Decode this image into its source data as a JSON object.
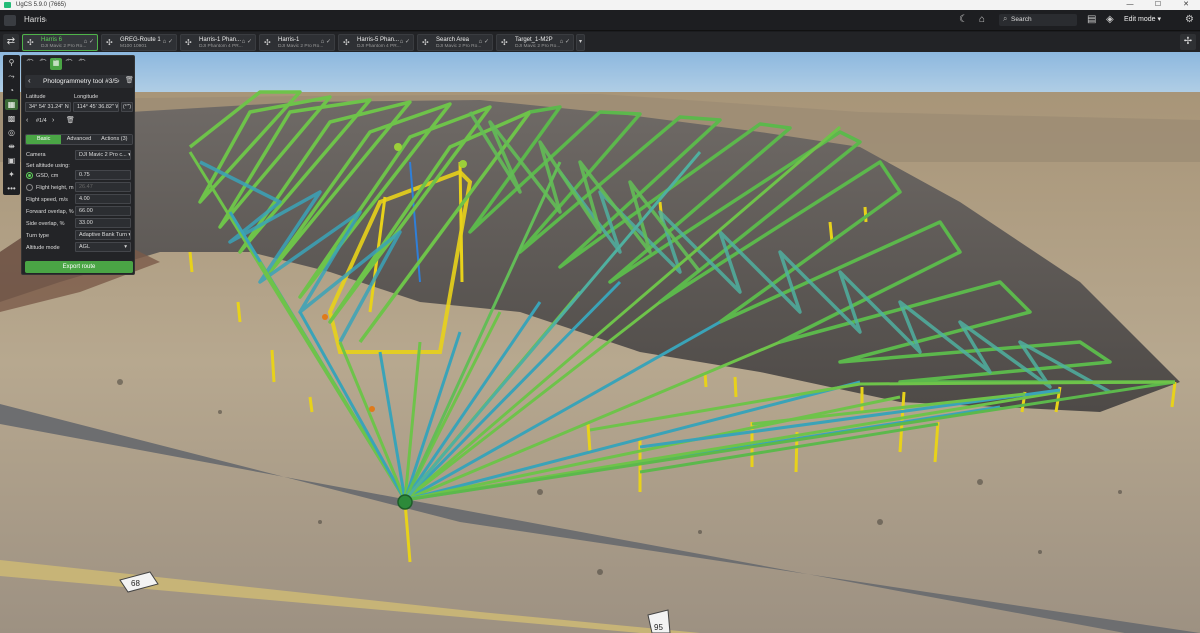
{
  "window": {
    "title": "UgCS 5.9.0 (7665)",
    "controls": [
      "—",
      "☐",
      "✕"
    ]
  },
  "topbar": {
    "mission_name": "Harris",
    "search_placeholder": "Search",
    "edit_mode_label": "Edit mode",
    "icons": [
      "night-mode-icon",
      "home-icon",
      "search-icon",
      "clipboard-icon",
      "layers-icon",
      "gear-icon"
    ]
  },
  "routes": [
    {
      "name": "Harris 6",
      "sub": "DJI Mavic 2 Pro Ro...",
      "active": true
    },
    {
      "name": "GREG-Route 1",
      "sub": "M100 10901",
      "active": false
    },
    {
      "name": "Harris-1 Phan...",
      "sub": "DJI Phantom 4 PR...",
      "active": false
    },
    {
      "name": "Harris-1",
      "sub": "DJI Mavic 2 Pro Ro...",
      "active": false
    },
    {
      "name": "Harris-5 Phan...",
      "sub": "DJI Phantom 4 PR...",
      "active": false
    },
    {
      "name": "Search Area",
      "sub": "DJI Mavic 2 Pro Ro...",
      "active": false
    },
    {
      "name": "Target_1-M2P",
      "sub": "DJI Mavic 2 Pro Ro...",
      "active": false
    }
  ],
  "panel": {
    "tabs": [
      "1",
      "2",
      "3",
      "4",
      "5"
    ],
    "tool_title": "Photogrammetry tool #3/5",
    "latitude_label": "Latitude",
    "longitude_label": "Longitude",
    "latitude_value": "34° 54' 31.24\" N",
    "longitude_value": "114° 45' 36.82\" W",
    "latlon_btn": "(°′″)",
    "point_index": "#1/4",
    "segments": [
      "Basic",
      "Advanced",
      "Actions (3)"
    ],
    "camera_label": "Camera",
    "camera_value": "DJI Mavic 2 Pro c...",
    "set_altitude_label": "Set altitude using:",
    "gsd_label": "GSD, cm",
    "gsd_value": "0.75",
    "flight_height_label": "Flight height, m",
    "flight_height_value": "26.47",
    "flight_speed_label": "Flight speed, m/s",
    "flight_speed_value": "4.00",
    "forward_overlap_label": "Forward overlap, %",
    "forward_overlap_value": "66.00",
    "side_overlap_label": "Side overlap, %",
    "side_overlap_value": "33.00",
    "turn_type_label": "Turn type",
    "turn_type_value": "Adaptive Bank Turn",
    "altitude_mode_label": "Altitude mode",
    "altitude_mode_value": "AGL",
    "export_label": "Export route"
  },
  "map": {
    "road_shield_1": "68",
    "road_shield_2": "95"
  },
  "colors": {
    "accent": "#4aa545",
    "route_line": "#6ec34a",
    "route_alt": "#3aa3b8",
    "pole": "#e8d21a",
    "sky": "#a7cbe6"
  }
}
